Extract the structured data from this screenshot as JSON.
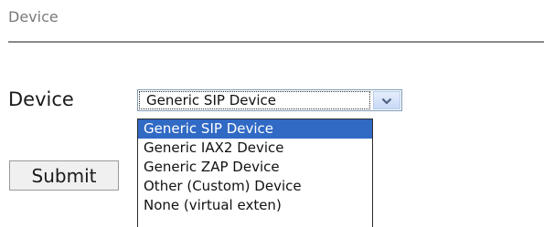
{
  "section": {
    "title": "Device"
  },
  "form": {
    "device_label": "Device",
    "device_select": {
      "value": "Generic SIP Device",
      "options": [
        "Generic SIP Device",
        "Generic IAX2 Device",
        "Generic ZAP Device",
        "Other (Custom) Device",
        "None (virtual exten)"
      ],
      "selected_index": 0
    },
    "submit_label": "Submit"
  },
  "colors": {
    "highlight": "#316ac5",
    "select_border": "#7f9db9",
    "divider": "#8a8a8a"
  },
  "icons": {
    "select_arrow": "chevron-down-icon"
  }
}
